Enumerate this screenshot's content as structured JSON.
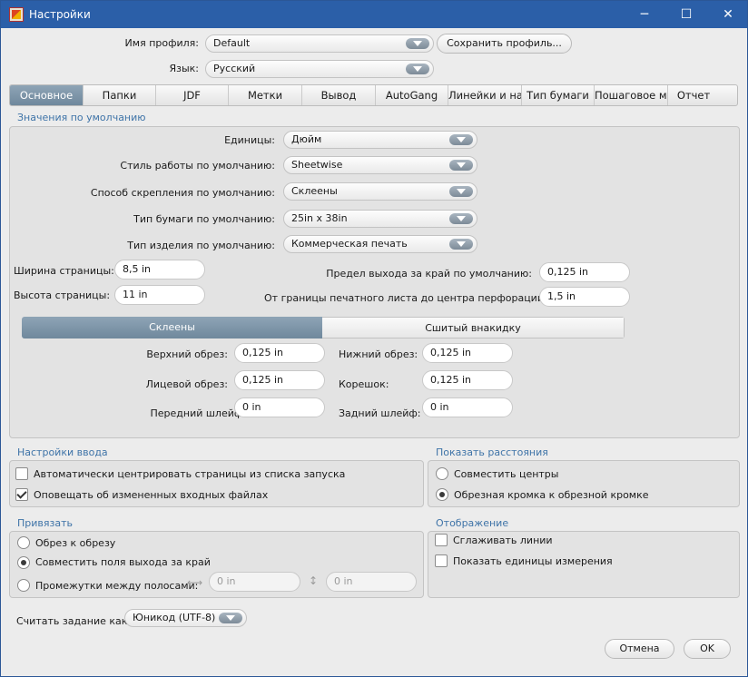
{
  "window": {
    "title": "Настройки",
    "minimize": "─",
    "maximize": "☐",
    "close": "✕"
  },
  "profile": {
    "label": "Имя профиля:",
    "value": "Default",
    "save_button": "Сохранить профиль..."
  },
  "language": {
    "label": "Язык:",
    "value": "Русский"
  },
  "tabs": [
    {
      "label": "Основное",
      "active": true
    },
    {
      "label": "Папки"
    },
    {
      "label": "JDF"
    },
    {
      "label": "Метки"
    },
    {
      "label": "Вывод"
    },
    {
      "label": "AutoGang"
    },
    {
      "label": "Линейки и нап"
    },
    {
      "label": "Тип бумаги"
    },
    {
      "label": "Пошаговое му"
    },
    {
      "label": "Отчет"
    }
  ],
  "defaults": {
    "section_title": "Значения по умолчанию",
    "units": {
      "label": "Единицы:",
      "value": "Дюйм"
    },
    "work_style": {
      "label": "Стиль работы по умолчанию:",
      "value": "Sheetwise"
    },
    "binding": {
      "label": "Способ скрепления по умолчанию:",
      "value": "Склеены"
    },
    "paper_type": {
      "label": "Тип бумаги по умолчанию:",
      "value": "25in x 38in"
    },
    "product_type": {
      "label": "Тип изделия по умолчанию:",
      "value": "Коммерческая печать"
    },
    "page_width": {
      "label": "Ширина страницы:",
      "value": "8,5 in"
    },
    "page_height": {
      "label": "Высота страницы:",
      "value": "11 in"
    },
    "bleed": {
      "label": "Предел выхода за край по умолчанию:",
      "value": "0,125 in"
    },
    "perforation": {
      "label": "От границы печатного листа до центра перфорации:",
      "value": "1,5 in"
    },
    "binding_tabs": {
      "glued": "Склеены",
      "sewn": "Сшитый внакидку"
    },
    "top_trim": {
      "label": "Верхний обрез:",
      "value": "0,125 in"
    },
    "bottom_trim": {
      "label": "Нижний обрез:",
      "value": "0,125 in"
    },
    "face_trim": {
      "label": "Лицевой обрез:",
      "value": "0,125 in"
    },
    "spine": {
      "label": "Корешок:",
      "value": "0,125 in"
    },
    "front_lip": {
      "label": "Передний шлейф:",
      "value": "0 in"
    },
    "back_lip": {
      "label": "Задний шлейф:",
      "value": "0 in"
    }
  },
  "input_settings": {
    "title": "Настройки ввода",
    "auto_center": {
      "label": "Автоматически центрировать страницы из списка запуска",
      "checked": false
    },
    "notify_changed": {
      "label": "Оповещать об измененных входных файлах",
      "checked": true
    }
  },
  "show_distances": {
    "title": "Показать расстояния",
    "align_centers": {
      "label": "Совместить центры",
      "selected": false
    },
    "trim_to_trim": {
      "label": "Обрезная кромка к обрезной кромке",
      "selected": true
    }
  },
  "snap": {
    "title": "Привязать",
    "trim_to_trim": {
      "label": "Обрез к обрезу",
      "selected": false
    },
    "align_bleeds": {
      "label": "Совместить поля выхода за край",
      "selected": true
    },
    "gutters": {
      "label": "Промежутки между полосами:",
      "selected": false,
      "h_value": "0 in",
      "v_value": "0 in"
    }
  },
  "display": {
    "title": "Отображение",
    "smooth_lines": {
      "label": "Сглаживать линии",
      "checked": false
    },
    "show_units": {
      "label": "Показать единицы измерения",
      "checked": false
    }
  },
  "read_job": {
    "label": "Считать задание как",
    "value": "Юникод (UTF-8)"
  },
  "buttons": {
    "cancel": "Отмена",
    "ok": "OK"
  }
}
